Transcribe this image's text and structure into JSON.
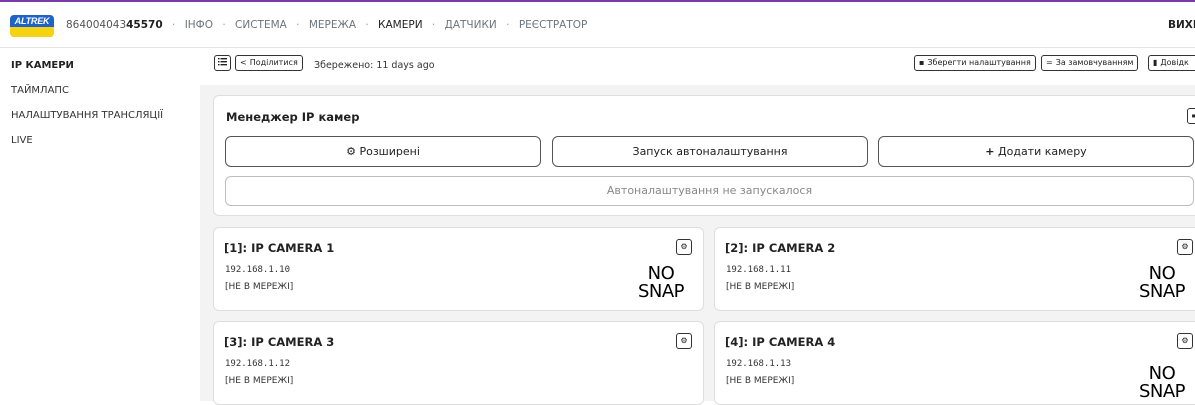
{
  "topbar": {
    "logo_text": "ALTREK",
    "serial_prefix": "864004043",
    "serial_suffix": "45570",
    "nav_items": [
      "ІНФО",
      "СИСТЕМА",
      "МЕРЕЖА",
      "КАМЕРИ",
      "ДАТЧИКИ",
      "РЕЄСТРАТОР"
    ],
    "exit_label": "ВИХІ",
    "active_color": "#7a3aa8"
  },
  "sidebar": {
    "items": [
      "IP КАМЕРИ",
      "ТАЙМЛАПС",
      "НАЛАШТУВАННЯ ТРАНСЛЯЦІЇ",
      "LIVE"
    ]
  },
  "toolbar": {
    "menu_icon": "list-icon",
    "share_label": "Поділитися",
    "saved_text": "Збережено: 11 days ago",
    "save_settings_label": "Зберегти налаштування",
    "defaults_label": "За замовчуванням",
    "help_label": "Довідк"
  },
  "manager": {
    "title": "Менеджер IP камер",
    "advanced_label": "Розширені",
    "autoconfig_label": "Запуск автоналаштування",
    "add_camera_label": "Додати камеру",
    "status_text": "Автоналаштування не запускалося"
  },
  "cameras": [
    {
      "title": "[1]: IP CAMERA 1",
      "ip": "192.168.1.10",
      "state": "[НЕ В МЕРЕЖІ]",
      "snap_line1": "NO",
      "snap_line2": "SNAP"
    },
    {
      "title": "[2]: IP CAMERA 2",
      "ip": "192.168.1.11",
      "state": "[НЕ В МЕРЕЖІ]",
      "snap_line1": "NO",
      "snap_line2": "SNAP"
    },
    {
      "title": "[3]: IP CAMERA 3",
      "ip": "192.168.1.12",
      "state": "[НЕ В МЕРЕЖІ]",
      "snap_line1": "",
      "snap_line2": ""
    },
    {
      "title": "[4]: IP CAMERA 4",
      "ip": "192.168.1.13",
      "state": "[НЕ В МЕРЕЖІ]",
      "snap_line1": "NO",
      "snap_line2": "SNAP"
    }
  ]
}
